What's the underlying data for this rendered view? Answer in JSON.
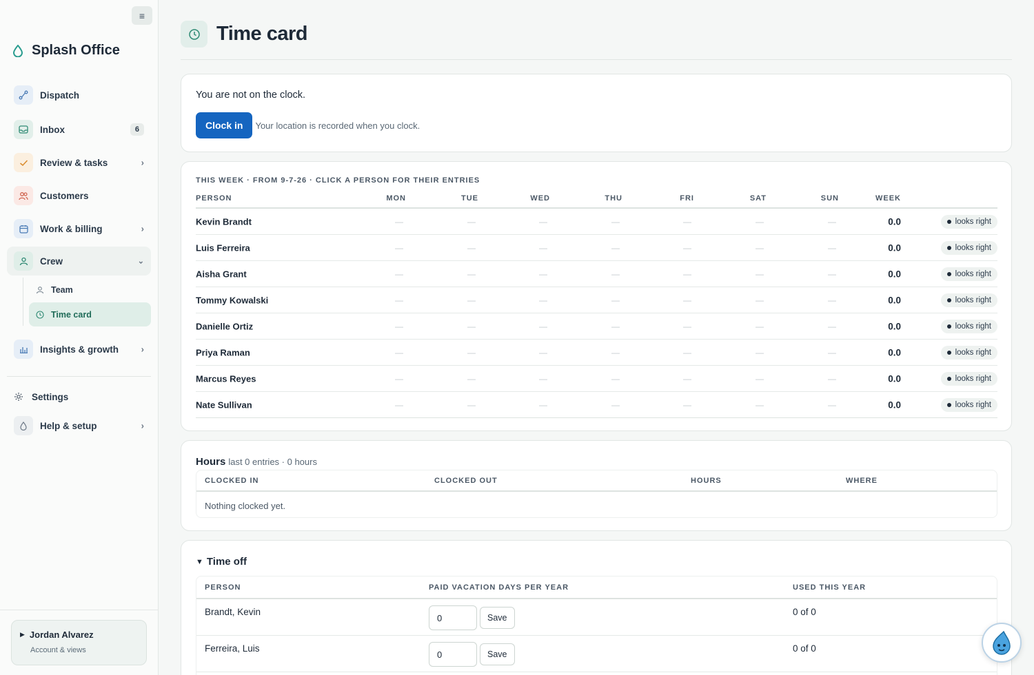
{
  "app": {
    "name": "Splash Office"
  },
  "sidebar": {
    "items": [
      {
        "label": "Dispatch",
        "icon": "dispatch-icon"
      },
      {
        "label": "Inbox",
        "icon": "inbox-icon",
        "count": "6"
      },
      {
        "label": "Review & tasks",
        "icon": "check-icon"
      },
      {
        "label": "Customers",
        "icon": "customers-icon"
      },
      {
        "label": "Work & billing",
        "icon": "calendar-icon"
      },
      {
        "label": "Crew",
        "icon": "crew-icon"
      },
      {
        "label": "Insights & growth",
        "icon": "chart-icon"
      }
    ],
    "crew_sub": [
      {
        "label": "Team",
        "icon": "person-icon"
      },
      {
        "label": "Time card",
        "icon": "clock-icon"
      }
    ],
    "settings": "Settings",
    "help": "Help & setup",
    "user": {
      "name": "Jordan Alvarez",
      "sub": "Account & views"
    }
  },
  "page": {
    "title": "Time card"
  },
  "clock": {
    "status": "You are not on the clock.",
    "button": "Clock in",
    "note": "Your location is recorded when you clock."
  },
  "week": {
    "caption": "This week · from 9-7-26 · click a person for their entries",
    "columns": [
      "Person",
      "Mon",
      "Tue",
      "Wed",
      "Thu",
      "Fri",
      "Sat",
      "Sun",
      "Week"
    ],
    "rows": [
      {
        "name": "Kevin Brandt",
        "days": [
          "—",
          "—",
          "—",
          "—",
          "—",
          "—",
          "—"
        ],
        "week": "0.0",
        "status": "looks right"
      },
      {
        "name": "Luis Ferreira",
        "days": [
          "—",
          "—",
          "—",
          "—",
          "—",
          "—",
          "—"
        ],
        "week": "0.0",
        "status": "looks right"
      },
      {
        "name": "Aisha Grant",
        "days": [
          "—",
          "—",
          "—",
          "—",
          "—",
          "—",
          "—"
        ],
        "week": "0.0",
        "status": "looks right"
      },
      {
        "name": "Tommy Kowalski",
        "days": [
          "—",
          "—",
          "—",
          "—",
          "—",
          "—",
          "—"
        ],
        "week": "0.0",
        "status": "looks right"
      },
      {
        "name": "Danielle Ortiz",
        "days": [
          "—",
          "—",
          "—",
          "—",
          "—",
          "—",
          "—"
        ],
        "week": "0.0",
        "status": "looks right"
      },
      {
        "name": "Priya Raman",
        "days": [
          "—",
          "—",
          "—",
          "—",
          "—",
          "—",
          "—"
        ],
        "week": "0.0",
        "status": "looks right"
      },
      {
        "name": "Marcus Reyes",
        "days": [
          "—",
          "—",
          "—",
          "—",
          "—",
          "—",
          "—"
        ],
        "week": "0.0",
        "status": "looks right"
      },
      {
        "name": "Nate Sullivan",
        "days": [
          "—",
          "—",
          "—",
          "—",
          "—",
          "—",
          "—"
        ],
        "week": "0.0",
        "status": "looks right"
      }
    ]
  },
  "hours": {
    "title": "Hours",
    "summary": "last 0 entries · 0 hours",
    "columns": [
      "Clocked in",
      "Clocked out",
      "Hours",
      "Where"
    ],
    "empty": "Nothing clocked yet."
  },
  "timeoff": {
    "title": "Time off",
    "columns": [
      "Person",
      "Paid vacation days per year",
      "Used this year"
    ],
    "rows": [
      {
        "name": "Brandt, Kevin",
        "days": "0",
        "save": "Save",
        "used": "0 of 0"
      },
      {
        "name": "Ferreira, Luis",
        "days": "0",
        "save": "Save",
        "used": "0 of 0"
      }
    ]
  },
  "colors": {
    "primary": "#1565c0",
    "accent_green": "#e2eeea",
    "text": "#1e2a38"
  }
}
